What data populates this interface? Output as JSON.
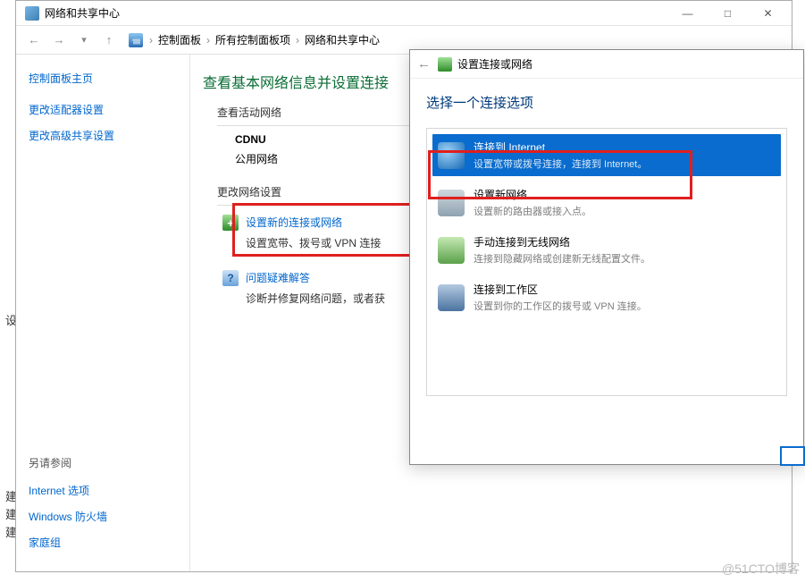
{
  "window": {
    "title": "网络和共享中心",
    "controls": {
      "min": "—",
      "max": "□",
      "close": "✕"
    }
  },
  "nav": {
    "back": "←",
    "fwd": "→",
    "up": "↑",
    "breadcrumbs": [
      "控制面板",
      "所有控制面板项",
      "网络和共享中心"
    ]
  },
  "sidebar": {
    "home": "控制面板主页",
    "links": [
      "更改适配器设置",
      "更改高级共享设置"
    ],
    "see_also_label": "另请参阅",
    "see_also": [
      "Internet 选项",
      "Windows 防火墙",
      "家庭组"
    ]
  },
  "main": {
    "heading": "查看基本网络信息并设置连接",
    "active_net_label": "查看活动网络",
    "net_name": "CDNU",
    "net_type": "公用网络",
    "change_label": "更改网络设置",
    "option1": {
      "title": "设置新的连接或网络",
      "desc": "设置宽带、拨号或 VPN 连接"
    },
    "option2": {
      "title": "问题疑难解答",
      "desc": "诊断并修复网络问题，或者获"
    }
  },
  "dialog": {
    "title": "设置连接或网络",
    "heading": "选择一个连接选项",
    "options": [
      {
        "title": "连接到 Internet",
        "desc": "设置宽带或拨号连接，连接到 Internet。",
        "selected": true,
        "icon": "globe"
      },
      {
        "title": "设置新网络",
        "desc": "设置新的路由器或接入点。",
        "selected": false,
        "icon": "router"
      },
      {
        "title": "手动连接到无线网络",
        "desc": "连接到隐藏网络或创建新无线配置文件。",
        "selected": false,
        "icon": "wifi"
      },
      {
        "title": "连接到工作区",
        "desc": "设置到你的工作区的拨号或 VPN 连接。",
        "selected": false,
        "icon": "work"
      }
    ]
  },
  "stray_chars": {
    "c1": "设",
    "c2": "建",
    "c3": "建",
    "c4": "建"
  },
  "watermark": "@51CTO博客"
}
